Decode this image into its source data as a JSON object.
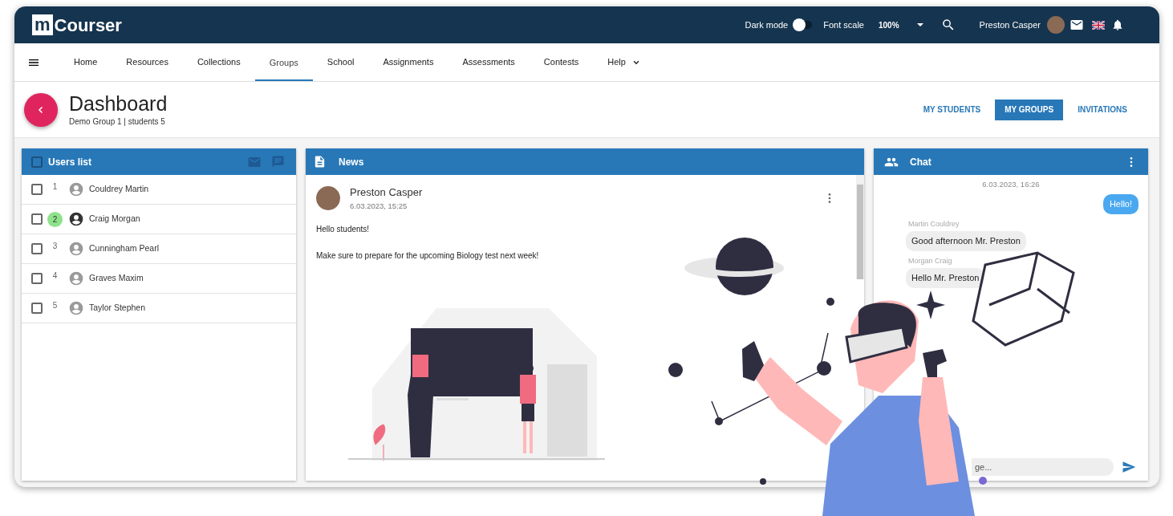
{
  "header": {
    "logo_mark": "m",
    "logo_text": "Courser",
    "dark_mode": {
      "label": "Dark mode",
      "on": false
    },
    "font_scale": {
      "label": "Font scale",
      "value": "100%"
    },
    "user_name": "Preston Casper"
  },
  "nav": [
    {
      "label": "Home",
      "selected": false
    },
    {
      "label": "Resources",
      "selected": false
    },
    {
      "label": "Collections",
      "selected": false
    },
    {
      "label": "Groups",
      "selected": true
    },
    {
      "label": "School",
      "selected": false
    },
    {
      "label": "Assignments",
      "selected": false
    },
    {
      "label": "Assessments",
      "selected": false
    },
    {
      "label": "Contests",
      "selected": false
    },
    {
      "label": "Help",
      "selected": false,
      "dropdown": true
    }
  ],
  "page": {
    "title": "Dashboard",
    "subtitle": "Demo Group 1 | students 5"
  },
  "view_tabs": [
    {
      "label": "MY STUDENTS",
      "selected": false
    },
    {
      "label": "MY GROUPS",
      "selected": true
    },
    {
      "label": "INVITATIONS",
      "selected": false
    }
  ],
  "users_panel": {
    "title": "Users list",
    "checked": false,
    "users": [
      {
        "number": "1",
        "name": "Couldrey Martin",
        "checked": false,
        "online": false
      },
      {
        "number": "2",
        "name": "Craig Morgan",
        "checked": false,
        "online": true
      },
      {
        "number": "3",
        "name": "Cunningham Pearl",
        "checked": false,
        "online": false
      },
      {
        "number": "4",
        "name": "Graves Maxim",
        "checked": false,
        "online": false
      },
      {
        "number": "5",
        "name": "Taylor Stephen",
        "checked": false,
        "online": false
      }
    ]
  },
  "news_panel": {
    "title": "News",
    "post": {
      "author": "Preston Casper",
      "date": "6.03.2023, 15:25",
      "paragraphs": [
        "Hello students!",
        "Make sure to prepare for the upcoming Biology test next week!"
      ]
    }
  },
  "chat_panel": {
    "title": "Chat",
    "timestamp": "6.03.2023, 16:26",
    "messages": [
      {
        "kind": "own",
        "text": "Hello!"
      },
      {
        "kind": "other",
        "sender": "Martin Couldrey",
        "text": "Good afternoon Mr. Preston"
      },
      {
        "kind": "other",
        "sender": "Morgan Craig",
        "text": "Hello Mr. Preston"
      }
    ],
    "input": {
      "placeholder": "ge..."
    }
  }
}
